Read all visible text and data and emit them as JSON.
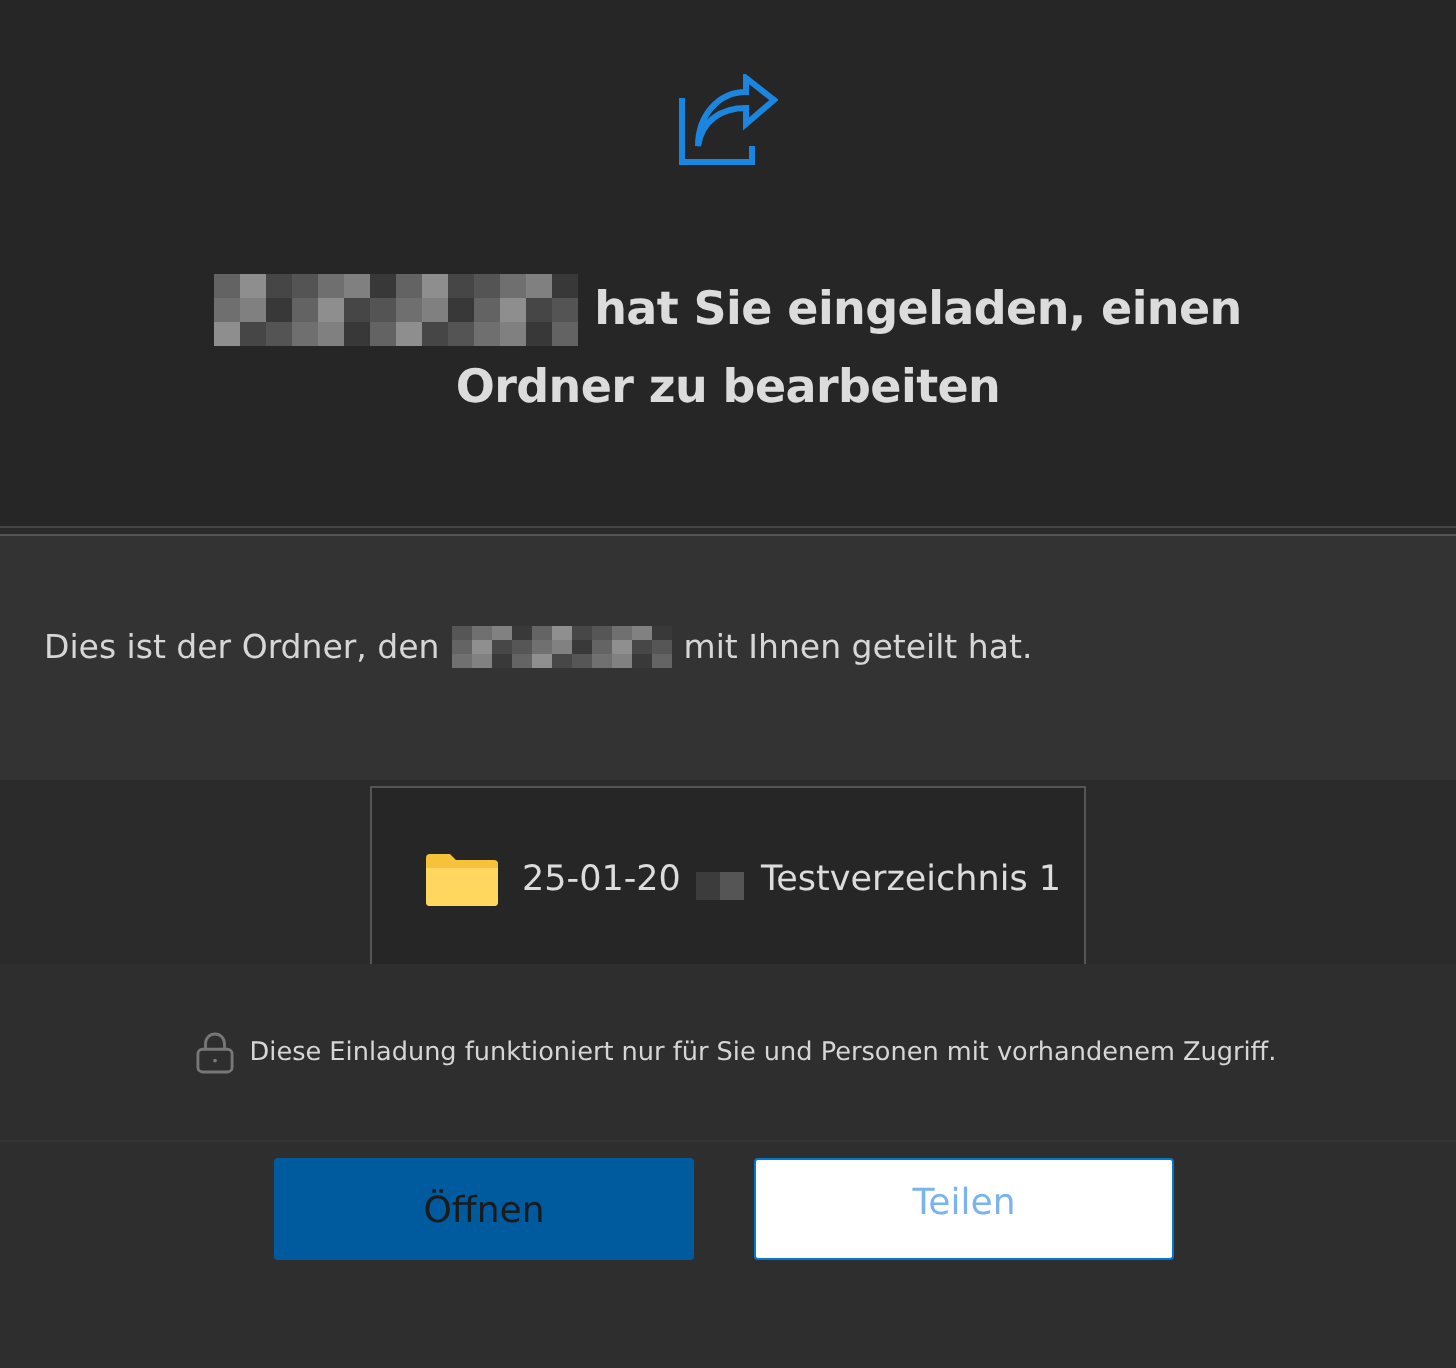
{
  "header": {
    "title_line_1": "hat Sie eingeladen, einen",
    "title_line_2": "Ordner zu bearbeiten"
  },
  "message": {
    "before": "Dies ist der Ordner, den",
    "after": "mit Ihnen geteilt hat."
  },
  "folder": {
    "name_start": "25-01-20",
    "name_end": "Testverzeichnis 1"
  },
  "notice": "Diese Einladung funktioniert nur für Sie und Personen mit vorhandenem Zugriff.",
  "buttons": [
    {
      "label": "Öffnen",
      "kind": "primary"
    },
    {
      "label": "Teilen",
      "kind": "secondary"
    }
  ]
}
